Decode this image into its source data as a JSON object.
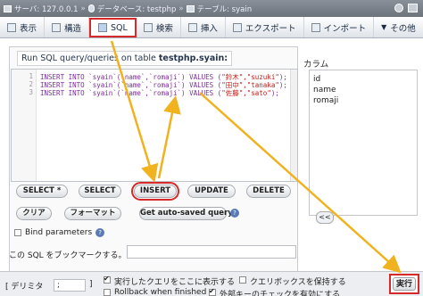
{
  "breadcrumb": {
    "server": "サーバ: 127.0.0.1",
    "database": "データベース: testphp",
    "table": "テーブル: syain",
    "separator": "»"
  },
  "tabs": [
    {
      "label": "表示",
      "icon": "browse-icon"
    },
    {
      "label": "構造",
      "icon": "structure-icon"
    },
    {
      "label": "SQL",
      "icon": "sql-icon",
      "active": true
    },
    {
      "label": "検索",
      "icon": "search-icon"
    },
    {
      "label": "挿入",
      "icon": "insert-icon"
    },
    {
      "label": "エクスポート",
      "icon": "export-icon"
    },
    {
      "label": "インポート",
      "icon": "import-icon"
    },
    {
      "label": "その他",
      "icon": "more-icon"
    }
  ],
  "query_panel": {
    "title_prefix": "Run SQL query/queries on table ",
    "title_table": "testphp.syain:"
  },
  "editor": {
    "lines": [
      {
        "n": "1",
        "text": "INSERT INTO `syain`(`name`,`romaji`) VALUES (",
        "val": "\"鈴木\",\"suzuki\"",
        "end": ");"
      },
      {
        "n": "2",
        "text": "INSERT INTO `syain`(`name`,`romaji`) VALUES (",
        "val": "\"田中\",\"tanaka\"",
        "end": ");"
      },
      {
        "n": "3",
        "text": "INSERT INTO `syain`(`name`,`romaji`) VALUES (",
        "val": "\"佐藤\",\"sato\"",
        "end": ");"
      }
    ]
  },
  "columns": {
    "title": "カラム",
    "items": [
      "id",
      "name",
      "romaji"
    ],
    "insert_label": "<<"
  },
  "buttons": {
    "select_all": "SELECT *",
    "select": "SELECT",
    "insert": "INSERT",
    "update": "UPDATE",
    "delete": "DELETE",
    "clear": "クリア",
    "format": "フォーマット",
    "get_saved": "Get auto-saved query"
  },
  "bind_params": "Bind parameters",
  "bookmark_label": "この SQL をブックマークする。",
  "footer": {
    "delimiter_label": "[ デリミタ",
    "delimiter_value": ";",
    "delimiter_close": "]",
    "show_query": "実行したクエリをここに表示する",
    "keep_box": "クエリボックスを保持する",
    "rollback": "Rollback when finished",
    "fk_check": "外部キーのチェックを有効にする",
    "run": "実行"
  },
  "colors": {
    "highlight": "#d62a2a",
    "arrow": "#f0b21e"
  }
}
